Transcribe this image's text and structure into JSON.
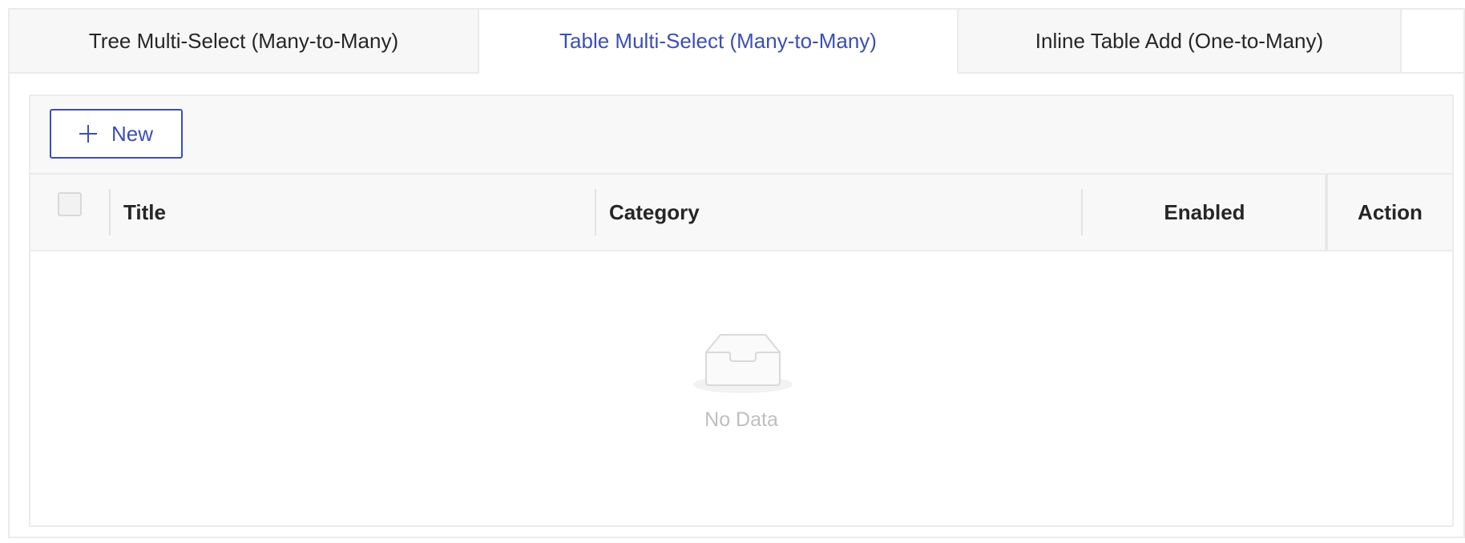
{
  "tabs": [
    {
      "label": "Tree Multi-Select (Many-to-Many)",
      "active": false
    },
    {
      "label": "Table Multi-Select (Many-to-Many)",
      "active": true
    },
    {
      "label": "Inline Table Add (One-to-Many)",
      "active": false
    }
  ],
  "toolbar": {
    "new_label": "New",
    "new_icon": "plus-icon"
  },
  "table": {
    "columns": [
      "Title",
      "Category",
      "Enabled",
      "Action"
    ],
    "rows": [],
    "empty_text": "No Data",
    "empty_icon": "empty-inbox-icon"
  },
  "colors": {
    "accent": "#3c4fb5",
    "border": "#ebebeb",
    "header_bg": "#f8f8f8",
    "empty_text": "#bfbfbf"
  }
}
